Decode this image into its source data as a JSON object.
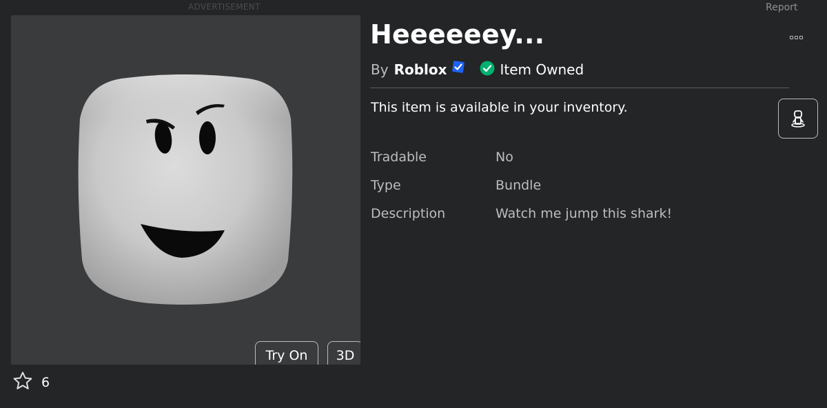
{
  "header": {
    "ad_label": "ADVERTISEMENT",
    "report_label": "Report"
  },
  "item": {
    "title": "Heeeeeey...",
    "by_label": "By",
    "creator": "Roblox",
    "owned_label": "Item Owned",
    "availability": "This item is available in your inventory.",
    "favorite_count": "6",
    "buttons": {
      "try_on": "Try On",
      "three_d": "3D"
    },
    "details": [
      {
        "label": "Tradable",
        "value": "No"
      },
      {
        "label": "Type",
        "value": "Bundle"
      },
      {
        "label": "Description",
        "value": "Watch me jump this shark!"
      }
    ]
  },
  "icons": {
    "verified": "verified-badge-icon",
    "owned": "checkmark-circle-icon",
    "more": "more-options-icon",
    "avatar": "avatar-view-icon",
    "favorite": "star-outline-icon"
  },
  "colors": {
    "background": "#232527",
    "panel": "#393b3d",
    "verified_blue": "#1e62f2",
    "owned_green": "#00b06f",
    "text_secondary": "#bdbebe"
  }
}
